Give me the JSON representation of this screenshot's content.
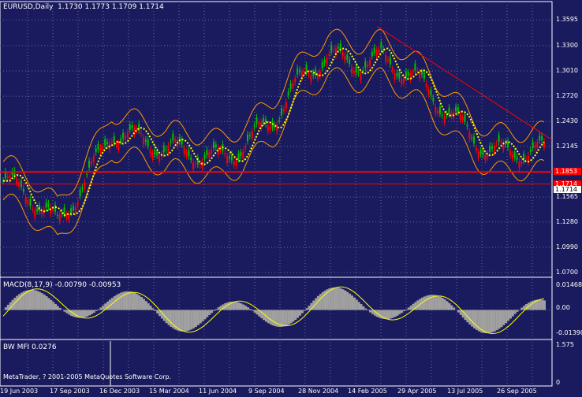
{
  "header": {
    "symbol": "EURUSD,Daily",
    "ohlc": "1.1730 1.1773 1.1709 1.1714"
  },
  "copyright": "MetaTrader, ? 2001-2005 MetaQuotes Software Corp.",
  "macd": {
    "label": "MACD(8,17,9) -0.00790 -0.00953",
    "axis": [
      "0.01468",
      "0.00",
      "-0.01390"
    ]
  },
  "mfi": {
    "label": "BW MFI 0.0276",
    "axis": [
      "1.575",
      "0"
    ]
  },
  "price_axis": [
    "1.3595",
    "1.3300",
    "1.3010",
    "1.2720",
    "1.2430",
    "1.2145",
    "1.1565",
    "1.1280",
    "1.0990",
    "1.0700"
  ],
  "price_tags": [
    "1.1853",
    "1.1714",
    "1.1714"
  ],
  "time_axis": [
    "19 Jun 2003",
    "17 Sep 2003",
    "16 Dec 2003",
    "15 Mar 2004",
    "11 Jun 2004",
    "9 Sep 2004",
    "28 Nov 2004",
    "14 Feb 2005",
    "29 Apr 2005",
    "13 Jul 2005",
    "26 Sep 2005"
  ],
  "colors": {
    "background": "#1a1a5e",
    "bull_candle": "#00c000",
    "bear_candle": "#ff0000",
    "moving_average": "#ffff00",
    "envelope": "#ff9900",
    "horizontal_lines": "#ff0000",
    "trendline": "#ff0000",
    "macd_hist": "#a0a0a0",
    "macd_signal": "#ffff00"
  },
  "chart_data": {
    "type": "line",
    "title": "EURUSD,Daily",
    "x": [
      "19 Jun 2003",
      "17 Sep 2003",
      "16 Dec 2003",
      "15 Mar 2004",
      "11 Jun 2004",
      "9 Sep 2004",
      "28 Nov 2004",
      "14 Feb 2005",
      "29 Apr 2005",
      "13 Jul 2005",
      "26 Sep 2005"
    ],
    "series": [
      {
        "name": "",
        "values": [
          1.175,
          1.12,
          1.24,
          1.2,
          1.21,
          1.24,
          1.32,
          1.32,
          1.26,
          1.22,
          1.2
        ]
      }
    ],
    "ylim": [
      1.07,
      1.375
    ],
    "grid": true
  }
}
